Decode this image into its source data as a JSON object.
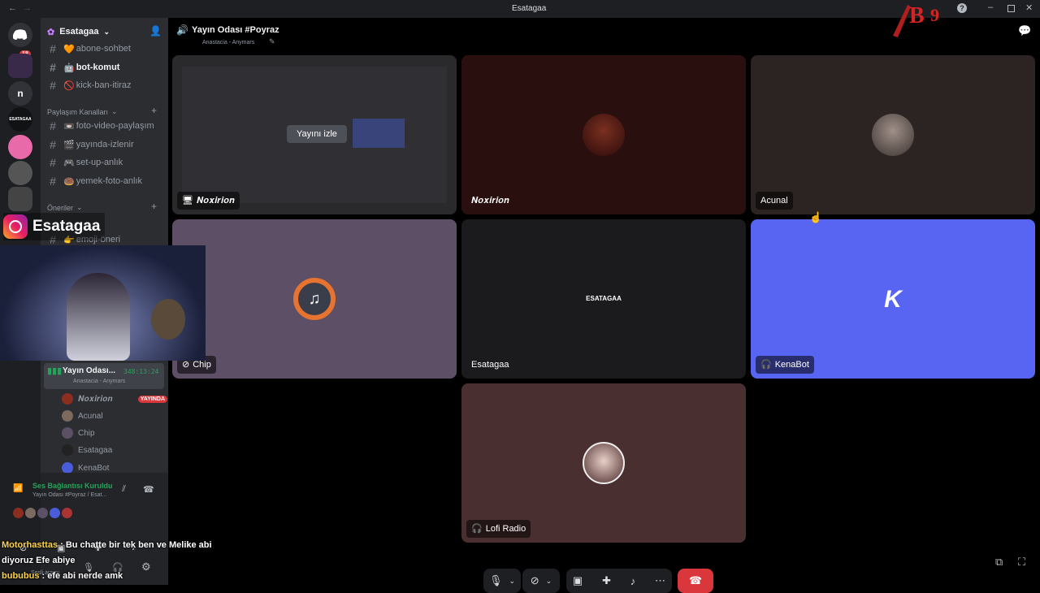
{
  "window": {
    "title": "Esatagaa"
  },
  "server": {
    "name": "Esatagaa",
    "badge": "18"
  },
  "servers": [
    {
      "icon": "discord-home-icon",
      "color": "#5865f2"
    },
    {
      "icon": "server-icon-multi",
      "color": "#3a2a4a"
    },
    {
      "icon": "server-n",
      "label": "n",
      "color": "#313338"
    },
    {
      "icon": "server-esatagaa",
      "label": "ESATAGAA",
      "color": "#111214"
    },
    {
      "icon": "server-anime",
      "color": "#e86aa8"
    },
    {
      "icon": "server-cat",
      "color": "#555"
    },
    {
      "icon": "server-dark",
      "color": "#444"
    }
  ],
  "channels": {
    "top": [
      {
        "name": "abone-sohbet",
        "emoji": "🧡"
      },
      {
        "name": "bot-komut",
        "emoji": "🤖",
        "active": true
      },
      {
        "name": "kick-ban-itiraz",
        "emoji": "🚫"
      }
    ],
    "category_share": "Paylaşım Kanalları",
    "share": [
      {
        "name": "foto-video-paylaşım",
        "emoji": "📼"
      },
      {
        "name": "yayında-izlenir",
        "emoji": "🎬"
      },
      {
        "name": "set-up-anlık",
        "emoji": "🎮"
      },
      {
        "name": "yemek-foto-anlık",
        "emoji": "🍩"
      }
    ],
    "category_suggest": "Öneriler",
    "suggest": [
      {
        "name": "emoji-öneri",
        "emoji": "👉"
      }
    ]
  },
  "voice_channel": {
    "name": "Yayın Odası...",
    "time": "348:13:24",
    "sub": "Anastacia - Anymars",
    "members": [
      {
        "name": "𝑵𝒐𝒙𝒊𝒓𝒊𝒐𝒏",
        "badge": "YAYINDA",
        "color": "#8b2e20"
      },
      {
        "name": "Acunal",
        "color": "#7a6a60"
      },
      {
        "name": "Chip",
        "color": "#5c5066"
      },
      {
        "name": "Esatagaa",
        "color": "#222"
      },
      {
        "name": "KenaBot",
        "color": "#4a5cd9"
      }
    ]
  },
  "voice_status": {
    "title": "Ses Bağlantısı Kuruldu",
    "sub": "Yayın Odası #Poyraz / Esat..."
  },
  "header": {
    "channel": "Yayın Odası #Poyraz",
    "sub": "Anastacia - Anymars"
  },
  "overlay": {
    "instagram_name": "Esatagaa"
  },
  "tiles": [
    {
      "label": "𝑵𝒐𝒙𝒊𝒓𝒊𝒐𝒏",
      "watch": "Yayını izle",
      "color": "#2a2a2c"
    },
    {
      "label": "𝑵𝒐𝒙𝒊𝒓𝒊𝒐𝒏",
      "color": "#2a0f0f"
    },
    {
      "label": "Acunal",
      "color": "#2c2422"
    },
    {
      "label": "Chip",
      "color": "#5c4f66"
    },
    {
      "label": "Esatagaa",
      "center": "ESATAGAA",
      "color": "#1b1b1d"
    },
    {
      "label": "KenaBot",
      "center": "K",
      "color": "#5865f2"
    },
    {
      "label": "Lofi Radio",
      "color": "#4a2f31"
    }
  ],
  "chat": [
    {
      "user": "Motorhasttas",
      "text": " : Bu chatte bir tek ben ve Melike abi"
    },
    {
      "user": "",
      "text": "diyoruz Efe abiye"
    },
    {
      "user": "bububus",
      "text": " : efe abi nerde amk"
    }
  ],
  "user_panel": {
    "sub": "Sesli aramı"
  }
}
